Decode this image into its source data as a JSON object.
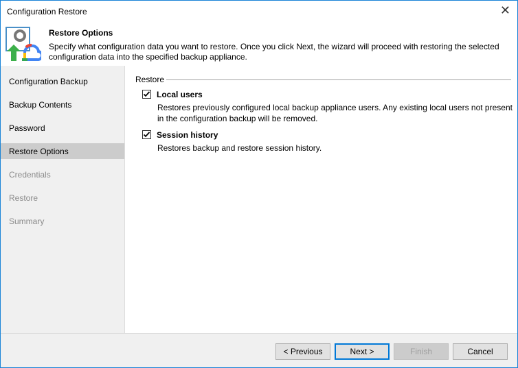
{
  "window": {
    "title": "Configuration Restore"
  },
  "header": {
    "title": "Restore Options",
    "description": "Specify what configuration data you want to restore. Once you click Next, the wizard will proceed with restoring the selected configuration data into the specified backup appliance."
  },
  "nav": {
    "items": [
      {
        "label": "Configuration Backup",
        "state": "normal"
      },
      {
        "label": "Backup Contents",
        "state": "normal"
      },
      {
        "label": "Password",
        "state": "normal"
      },
      {
        "label": "Restore Options",
        "state": "active"
      },
      {
        "label": "Credentials",
        "state": "disabled"
      },
      {
        "label": "Restore",
        "state": "disabled"
      },
      {
        "label": "Summary",
        "state": "disabled"
      }
    ]
  },
  "content": {
    "group_label": "Restore",
    "options": [
      {
        "label": "Local users",
        "checked": true,
        "description": "Restores previously configured local backup appliance users. Any existing local users not present in the configuration backup will be removed."
      },
      {
        "label": "Session history",
        "checked": true,
        "description": "Restores backup and restore session history."
      }
    ]
  },
  "footer": {
    "previous": "< Previous",
    "next": "Next >",
    "finish": "Finish",
    "cancel": "Cancel"
  },
  "colors": {
    "accent": "#0078d7",
    "active_nav": "#cccccc"
  }
}
